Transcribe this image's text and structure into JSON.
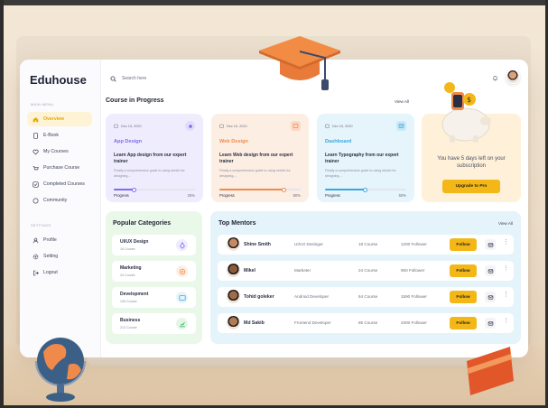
{
  "app": {
    "name": "Eduhouse"
  },
  "search": {
    "placeholder": "Search here"
  },
  "sidebar": {
    "main_menu_label": "MAIN MENU",
    "settings_label": "SETTINGS",
    "main_items": [
      {
        "label": "Overview",
        "icon": "home-icon",
        "active": true
      },
      {
        "label": "E-Book",
        "icon": "book-icon",
        "active": false
      },
      {
        "label": "My Courses",
        "icon": "heart-icon",
        "active": false
      },
      {
        "label": "Purchase Course",
        "icon": "cart-icon",
        "active": false
      },
      {
        "label": "Completed Courses",
        "icon": "check-icon",
        "active": false
      },
      {
        "label": "Community",
        "icon": "community-icon",
        "active": false
      }
    ],
    "settings_items": [
      {
        "label": "Profile",
        "icon": "user-icon"
      },
      {
        "label": "Setting",
        "icon": "gear-icon"
      },
      {
        "label": "Logout",
        "icon": "logout-icon"
      }
    ]
  },
  "courses": {
    "title": "Course in Progress",
    "view_all": "View All",
    "items": [
      {
        "date": "Dec 15, 2020",
        "name": "App Design",
        "desc": "Learn App design from our expert trainer",
        "sub": "Finally a comprehensive guide to using sketch for designing....",
        "progress_label": "Progress",
        "progress_value": "25%",
        "progress": 0.25,
        "accent": "#7b6cf0",
        "bg": "#efedfd"
      },
      {
        "date": "Dec 15, 2020",
        "name": "Web Design",
        "desc": "Learn Web design from our expert trainer",
        "sub": "Finally a comprehensive guide to using sketch for designing....",
        "progress_label": "Progress",
        "progress_value": "80%",
        "progress": 0.8,
        "accent": "#f08a4b",
        "bg": "#fdeee3"
      },
      {
        "date": "Dec 15, 2020",
        "name": "Dashboard",
        "desc": "Learn Typography from our expert trainer",
        "sub": "Finally a comprehensive guide to using sketch for designing....",
        "progress_label": "Progress",
        "progress_value": "50%",
        "progress": 0.5,
        "accent": "#3aa6e0",
        "bg": "#e6f4fb"
      }
    ]
  },
  "promo": {
    "text": "You have 5 days left on your subscription",
    "button": "Upgrade to Pro"
  },
  "categories": {
    "title": "Popular Categories",
    "items": [
      {
        "name": "UI/UX Design",
        "count": "16 Course",
        "icon": "pen-tool-icon",
        "color": "#7b6cf0",
        "bg": "#efedfd"
      },
      {
        "name": "Marketing",
        "count": "34 Course",
        "icon": "target-icon",
        "color": "#f08a4b",
        "bg": "#fdeee3"
      },
      {
        "name": "Development",
        "count": "126 Course",
        "icon": "code-icon",
        "color": "#3aa6e0",
        "bg": "#e6f4fb"
      },
      {
        "name": "Business",
        "count": "213 Course",
        "icon": "chart-icon",
        "color": "#37b35c",
        "bg": "#e5f6e9"
      }
    ]
  },
  "mentors": {
    "title": "Top Mentors",
    "view_all": "View All",
    "follow_label": "Follow",
    "items": [
      {
        "name": "Shine Smith",
        "role": "UI/UX Desinger",
        "courses": "18 Course",
        "followers": "1200 Follower"
      },
      {
        "name": "Mikel",
        "role": "Marketer",
        "courses": "24 Course",
        "followers": "900 Follower"
      },
      {
        "name": "Tohid goleker",
        "role": "Andriod Developer",
        "courses": "64 Course",
        "followers": "1590 Follower"
      },
      {
        "name": "Md Sakib",
        "role": "Frontend Developer",
        "courses": "85 Course",
        "followers": "3400 Follower"
      }
    ]
  },
  "colors": {
    "accent": "#f3b817",
    "active_nav": "#e3a800"
  }
}
